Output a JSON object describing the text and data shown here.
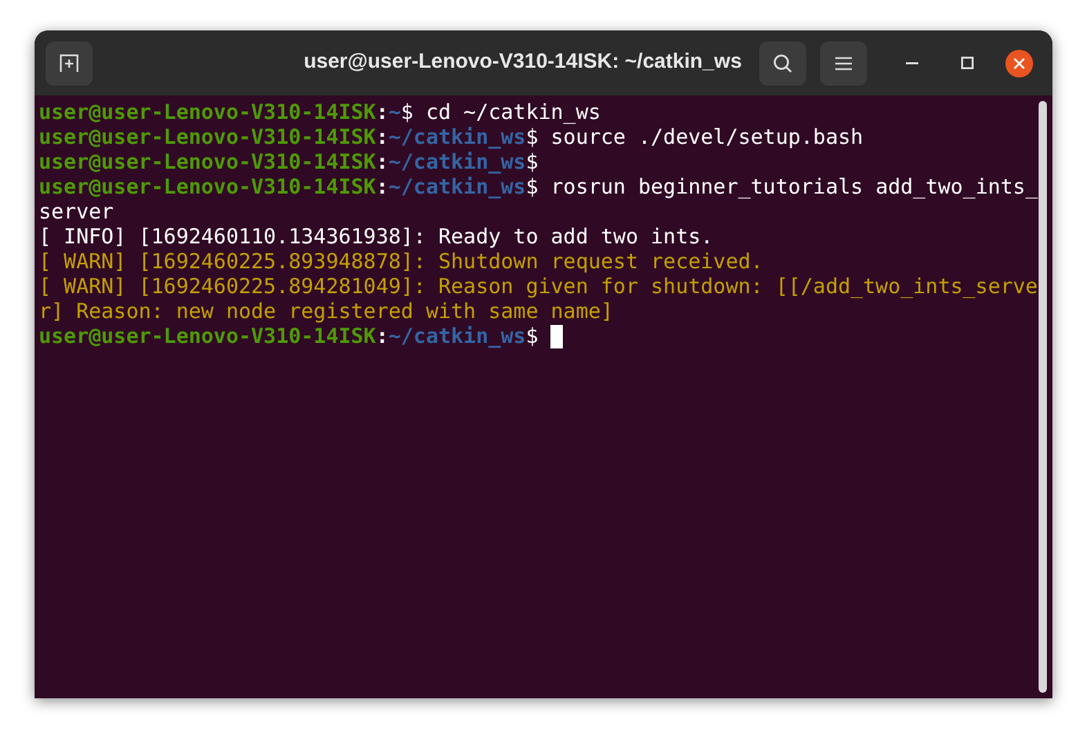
{
  "window": {
    "title": "user@user-Lenovo-V310-14ISK: ~/catkin_ws"
  },
  "terminal": {
    "lines": [
      {
        "kind": "prompt",
        "user": "user@user-Lenovo-V310-14ISK",
        "separator": ":",
        "path": "~",
        "symbol": "$",
        "command": "cd ~/catkin_ws",
        "cursor": false
      },
      {
        "kind": "prompt",
        "user": "user@user-Lenovo-V310-14ISK",
        "separator": ":",
        "path": "~/catkin_ws",
        "symbol": "$",
        "command": "source ./devel/setup.bash",
        "cursor": false
      },
      {
        "kind": "prompt",
        "user": "user@user-Lenovo-V310-14ISK",
        "separator": ":",
        "path": "~/catkin_ws",
        "symbol": "$",
        "cursor": false
      },
      {
        "kind": "prompt",
        "user": "user@user-Lenovo-V310-14ISK",
        "separator": ":",
        "path": "~/catkin_ws",
        "symbol": "$",
        "command": "rosrun beginner_tutorials add_two_ints_",
        "cursor": false
      },
      {
        "kind": "output",
        "text": "server"
      },
      {
        "kind": "info",
        "text": "[ INFO] [1692460110.134361938]: Ready to add two ints."
      },
      {
        "kind": "warn",
        "text": "[ WARN] [1692460225.893948878]: Shutdown request received."
      },
      {
        "kind": "warn",
        "text": "[ WARN] [1692460225.894281049]: Reason given for shutdown: [[/add_two_ints_serve"
      },
      {
        "kind": "warn",
        "text": "r] Reason: new node registered with same name]"
      },
      {
        "kind": "prompt",
        "user": "user@user-Lenovo-V310-14ISK",
        "separator": ":",
        "path": "~/catkin_ws",
        "symbol": "$",
        "cursor": true
      }
    ]
  }
}
